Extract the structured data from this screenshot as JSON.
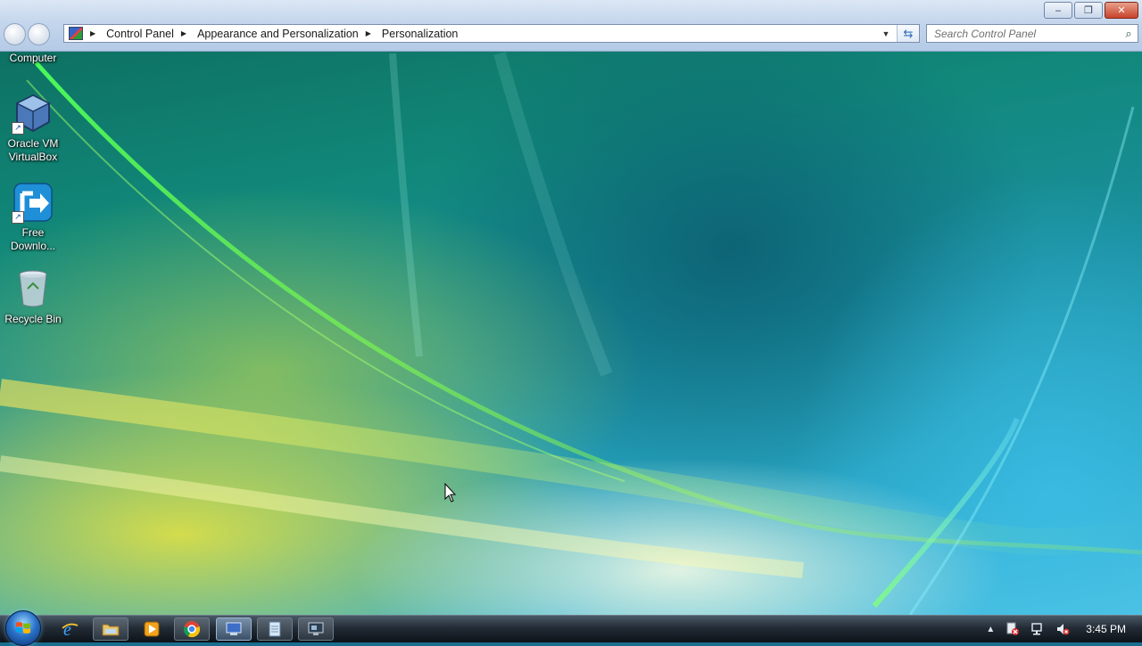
{
  "window": {
    "minimize_label": "–",
    "restore_label": "❐",
    "close_label": "✕"
  },
  "address_bar": {
    "breadcrumbs": [
      "Control Panel",
      "Appearance and Personalization",
      "Personalization"
    ]
  },
  "search": {
    "placeholder": "Search Control Panel"
  },
  "desktop_icons": [
    {
      "label": "Computer",
      "icon": "computer-icon"
    },
    {
      "label": "Oracle VM VirtualBox",
      "icon": "virtualbox-icon"
    },
    {
      "label": "Free Downlo...",
      "icon": "free-download-manager-icon"
    },
    {
      "label": "Recycle Bin",
      "icon": "recycle-bin-icon"
    }
  ],
  "taskbar": {
    "buttons": [
      {
        "name": "internet-explorer",
        "icon": "internet-explorer-icon"
      },
      {
        "name": "windows-explorer",
        "icon": "folder-icon"
      },
      {
        "name": "media-player",
        "icon": "media-player-icon"
      },
      {
        "name": "chrome",
        "icon": "chrome-icon"
      },
      {
        "name": "control-panel",
        "icon": "control-panel-icon"
      },
      {
        "name": "notepad",
        "icon": "notepad-icon"
      },
      {
        "name": "remote-desktop",
        "icon": "monitor-icon"
      }
    ],
    "clock": "3:45 PM"
  },
  "colors": {
    "taskbar": "#1c252e",
    "chrome_bar": "#c4d6ec",
    "close_button": "#c8432a"
  }
}
